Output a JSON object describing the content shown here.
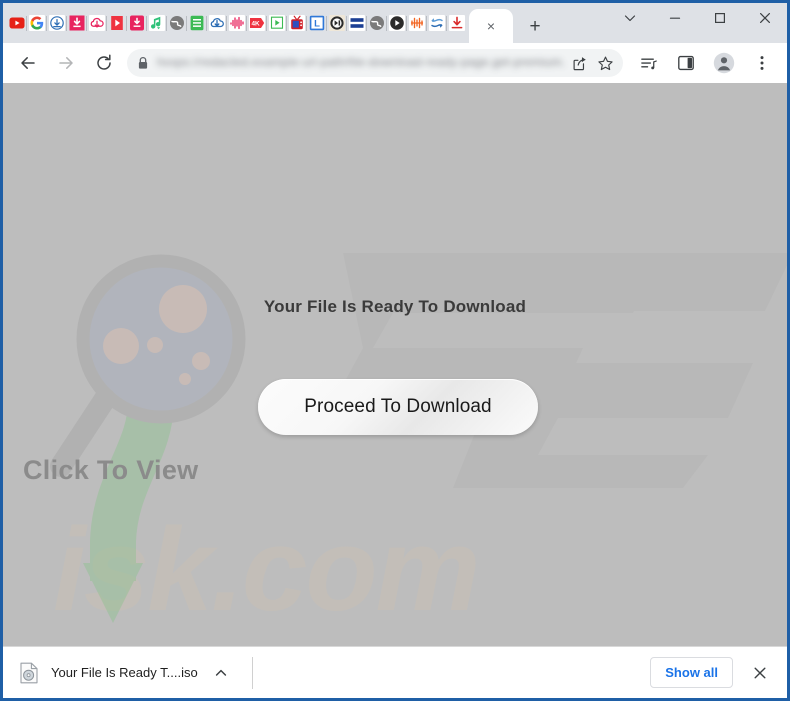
{
  "window": {
    "border_color": "#1f5fa6",
    "controls": [
      {
        "name": "tab-search",
        "icon": "chevron-down-icon",
        "label": ""
      },
      {
        "name": "minimize",
        "icon": "minimize-icon",
        "label": ""
      },
      {
        "name": "maximize",
        "icon": "maximize-icon",
        "label": ""
      },
      {
        "name": "close",
        "icon": "close-icon",
        "label": ""
      }
    ]
  },
  "tabstrip": {
    "pinned_tabs": [
      {
        "name": "youtube",
        "icon": "youtube-icon",
        "color": "#e62117"
      },
      {
        "name": "google",
        "icon": "google-g-icon",
        "color": "#4285f4"
      },
      {
        "name": "downloader-1",
        "icon": "cloud-download-icon",
        "color": "#2f6fb5"
      },
      {
        "name": "downloader-2",
        "icon": "download-box-icon",
        "color": "#e8245f"
      },
      {
        "name": "downloader-3",
        "icon": "cloud-arrow-icon",
        "color": "#e8245f"
      },
      {
        "name": "video-player-1",
        "icon": "play-square-icon",
        "color": "#ef3340"
      },
      {
        "name": "downloader-4",
        "icon": "download-box-icon",
        "color": "#e8245f"
      },
      {
        "name": "music-1",
        "icon": "music-note-icon",
        "color": "#2fc27a"
      },
      {
        "name": "browser-1",
        "icon": "globe-gray-icon",
        "color": "#7b7b7b"
      },
      {
        "name": "notes-1",
        "icon": "list-doc-icon",
        "color": "#3cba54"
      },
      {
        "name": "downloader-5",
        "icon": "cloud-download-icon",
        "color": "#2f6fb5"
      },
      {
        "name": "audio-1",
        "icon": "waveform-icon",
        "color": "#e8245f"
      },
      {
        "name": "video-4k",
        "icon": "4k-video-icon",
        "color": "#ef3340"
      },
      {
        "name": "player-2",
        "icon": "play-outline-icon",
        "color": "#3cba54"
      },
      {
        "name": "tv-1",
        "icon": "tv-icon",
        "color": "#d02028"
      },
      {
        "name": "lightshot",
        "icon": "letter-l-icon",
        "color": "#2f78d8"
      },
      {
        "name": "media-1",
        "icon": "pause-circle-icon",
        "color": "#3a3a3a"
      },
      {
        "name": "converter-1",
        "icon": "two-bars-icon",
        "color": "#1c3f94"
      },
      {
        "name": "browser-2",
        "icon": "globe-gray-icon",
        "color": "#7b7b7b"
      },
      {
        "name": "player-3",
        "icon": "play-circle-icon",
        "color": "#2b2b2b"
      },
      {
        "name": "audio-2",
        "icon": "sound-wave-icon",
        "color": "#f26522"
      },
      {
        "name": "converter-2",
        "icon": "refresh-arrows-icon",
        "color": "#5b9bd5"
      },
      {
        "name": "downloader-6",
        "icon": "download-underline-icon",
        "color": "#d92b2b"
      }
    ],
    "active_tab": {
      "title": "",
      "close_label": "×"
    },
    "new_tab_label": "+"
  },
  "toolbar": {
    "back_label": "",
    "forward_label": "",
    "reload_label": "",
    "omnibox": {
      "url_text": "hxxps://redacted.example-url-path/file-download-ready-page.get-premium.html",
      "lock_icon": "lock-icon"
    },
    "actions": [
      {
        "name": "share-button",
        "icon": "share-icon"
      },
      {
        "name": "bookmark-button",
        "icon": "star-icon"
      },
      {
        "name": "media-list-button",
        "icon": "playlist-icon"
      },
      {
        "name": "side-panel-button",
        "icon": "side-panel-icon"
      },
      {
        "name": "profile-button",
        "icon": "person-avatar-icon"
      },
      {
        "name": "menu-button",
        "icon": "three-dots-vertical-icon"
      }
    ]
  },
  "page": {
    "background_color": "#bdbdbd",
    "heading": "Your File Is Ready To Download",
    "button_label": "Proceed To Download",
    "watermark_click_to_view": "Click To View",
    "watermark_brand": "pcrisk.com",
    "watermark_brand_visible_text": "isk.com",
    "watermark_logo": "pc-logo-watermark"
  },
  "download_shelf": {
    "file_name": "Your File Is Ready T....iso",
    "file_icon": "disc-file-icon",
    "expand_icon": "chevron-up-icon",
    "show_all_label": "Show all",
    "close_label": "×"
  }
}
